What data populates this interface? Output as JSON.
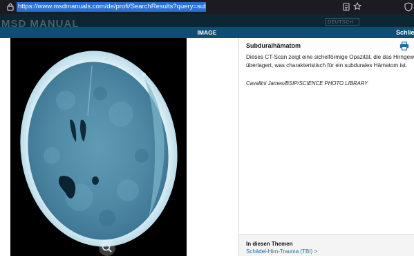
{
  "browser": {
    "url": "https://www.msdmanuals.com/de/profi/SearchResults?query=subdurales+hämatom",
    "icons": [
      "lock-icon",
      "reader-mode-icon",
      "bookmark-star-icon",
      "shield-icon"
    ]
  },
  "site_header": {
    "logo": "MSD MANUAL",
    "language": "DEUTSCH"
  },
  "modal": {
    "title": "IMAGE",
    "close_label": "Schlie"
  },
  "image": {
    "alt": "CT-Scan Subduralhämatom",
    "zoom_icon": "zoom-icon"
  },
  "caption": {
    "title": "Subduralhämatom",
    "text_line1": "Dieses CT-Scan zeigt eine sichelförmige Opazität, die das Hirngewebe",
    "text_line2": "überlagert, was charakteristisch für ein subdurales Hämatom ist.",
    "credit": "Cavallini James/BSIP/SCIENCE PHOTO LIBRARY",
    "print_icon": "print-icon"
  },
  "related": {
    "heading": "In diesen Themen",
    "link": "Schädel-Hirn-Trauma (TBI) >"
  },
  "colors": {
    "modal_bar": "#0d4f70",
    "url_highlight": "#2b6fd6",
    "link": "#1a6fa3"
  }
}
